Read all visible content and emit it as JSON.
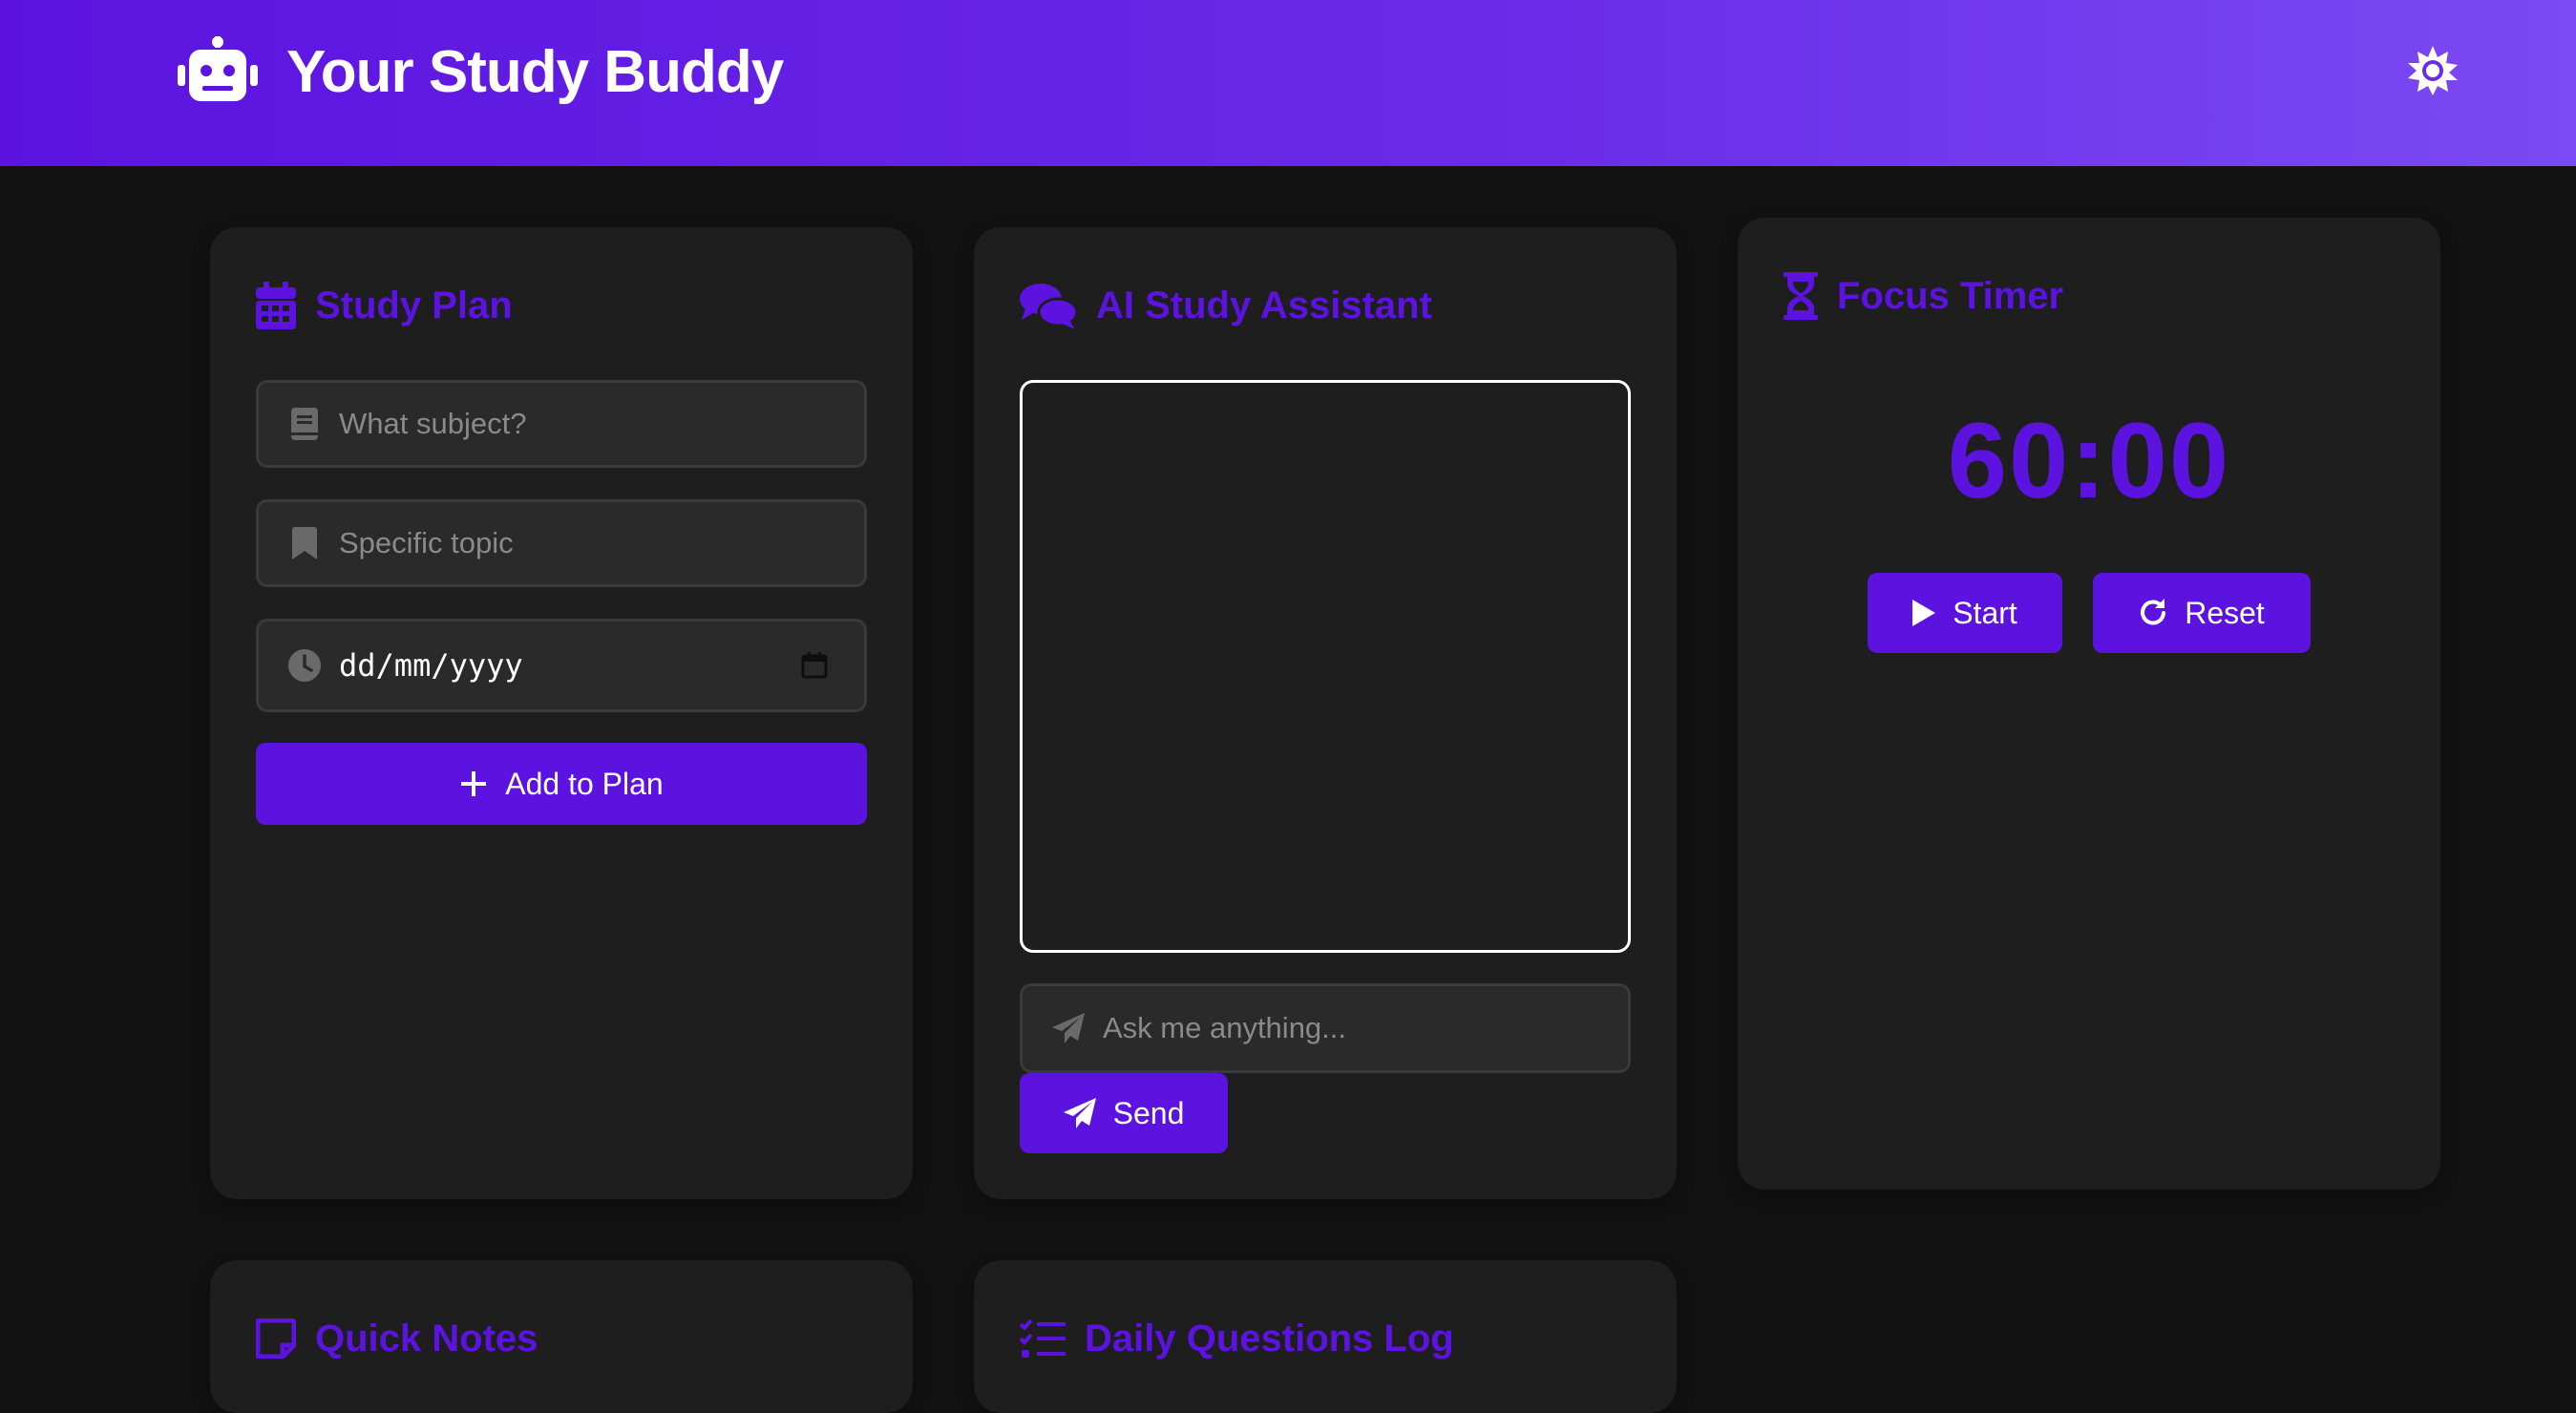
{
  "app": {
    "title": "Your Study Buddy",
    "accent_color": "#5c13e0",
    "background_color": "#121212",
    "card_color": "#1e1e1e",
    "logo_icon": "robot-icon",
    "theme_toggle_icon": "sun-icon"
  },
  "study_plan": {
    "title": "Study Plan",
    "icon": "calendar-icon",
    "subject_placeholder": "What subject?",
    "subject_icon": "book-icon",
    "topic_placeholder": "Specific topic",
    "topic_icon": "bookmark-icon",
    "date_value": "dd/mm/yyyy",
    "date_icon": "clock-icon",
    "add_button": "Add to Plan"
  },
  "assistant": {
    "title": "AI Study Assistant",
    "icon": "comments-icon",
    "input_placeholder": "Ask me anything...",
    "input_icon": "paper-plane-icon",
    "send_button": "Send"
  },
  "timer": {
    "title": "Focus Timer",
    "icon": "hourglass-icon",
    "display": "60:00",
    "start_button": "Start",
    "reset_button": "Reset"
  },
  "notes": {
    "title": "Quick Notes",
    "icon": "sticky-note-icon"
  },
  "questions_log": {
    "title": "Daily Questions Log",
    "icon": "list-check-icon"
  }
}
